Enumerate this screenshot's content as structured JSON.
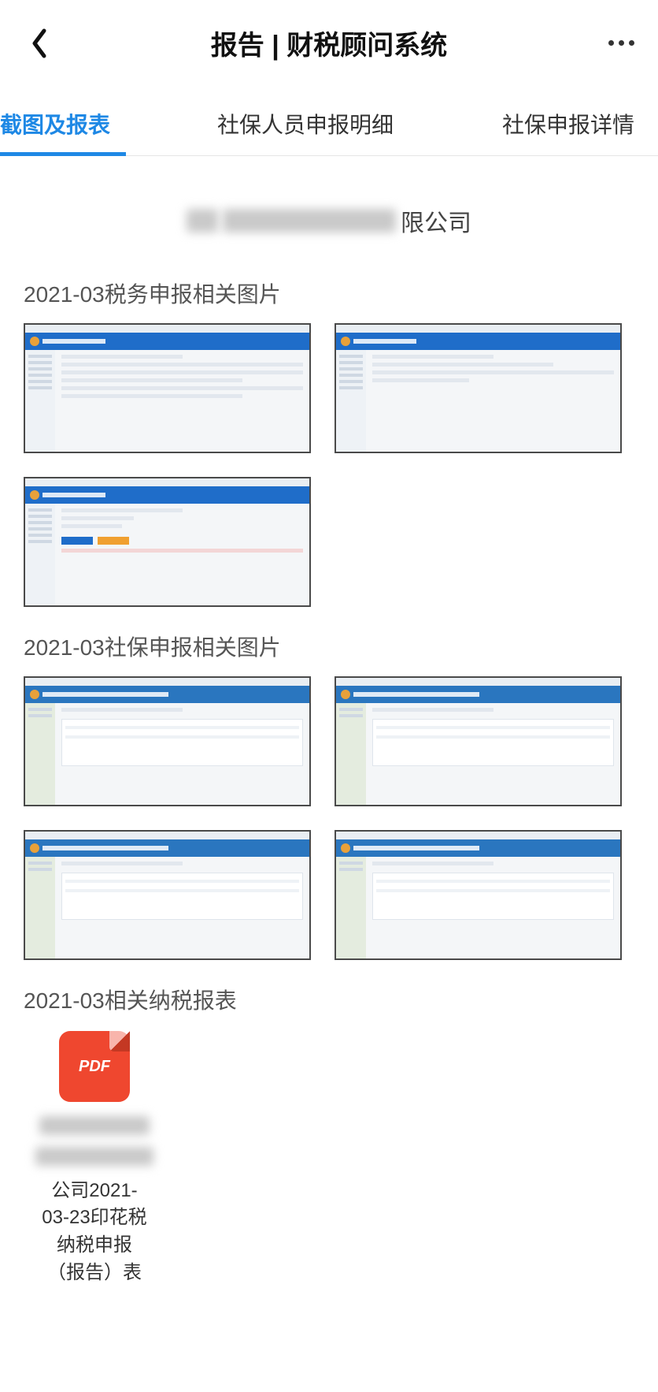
{
  "header": {
    "title": "报告 | 财税顾问系统"
  },
  "tabs": [
    {
      "label": "截图及报表",
      "active": true
    },
    {
      "label": "社保人员申报明细",
      "active": false
    },
    {
      "label": "社保申报详情",
      "active": false
    }
  ],
  "company": {
    "prefix_redacted": "福█",
    "middle_redacted": "████████████",
    "suffix": "限公司"
  },
  "sections": [
    {
      "key": "tax_images",
      "title": "2021-03税务申报相关图片",
      "thumbnails": [
        {
          "system": "国家税务总局福建省电子税务局",
          "variant": "list"
        },
        {
          "system": "国家税务总局福建省电子税务局",
          "variant": "form"
        },
        {
          "system": "国家税务总局福建省电子税务局",
          "variant": "upload"
        }
      ]
    },
    {
      "key": "social_images",
      "title": "2021-03社保申报相关图片",
      "thumbnails": [
        {
          "system": "福建省税务局社会保险费管理系统（网上申报）",
          "variant": "table"
        },
        {
          "system": "福建省税务局社会保险费管理系统（网上申报）",
          "variant": "table"
        },
        {
          "system": "福建省税务局社会保险费管理系统（网上申报）",
          "variant": "table"
        },
        {
          "system": "福建省税务局社会保险费管理系统（网上申报）",
          "variant": "table"
        }
      ]
    },
    {
      "key": "tax_reports",
      "title": "2021-03相关纳税报表",
      "files": [
        {
          "type": "PDF",
          "label_redacted_line1": "███████",
          "label_redacted_line2": "████████",
          "label_line3": "公司2021-",
          "label_line4": "03-23印花税",
          "label_line5": "纳税申报",
          "label_line6": "（报告）表"
        }
      ]
    }
  ],
  "colors": {
    "accent": "#1e88e5",
    "pdf": "#ef472f",
    "thumbnail_header": "#1f6dc9"
  }
}
